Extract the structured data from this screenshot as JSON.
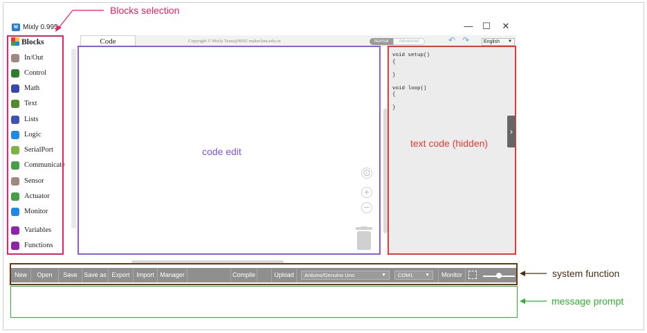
{
  "app": {
    "title": "Mixly 0.995",
    "logo_text": "M"
  },
  "window_controls": {
    "minimize": "—",
    "maximize": "☐",
    "close": "✕"
  },
  "sidebar": {
    "header": "Blocks",
    "items": [
      {
        "label": "In/Out",
        "icon": "inout-icon",
        "color": "#a1887f"
      },
      {
        "label": "Control",
        "icon": "control-icon",
        "color": "#2e7d32"
      },
      {
        "label": "Math",
        "icon": "math-icon",
        "color": "#3949ab"
      },
      {
        "label": "Text",
        "icon": "text-icon",
        "color": "#558b2f"
      },
      {
        "label": "Lists",
        "icon": "lists-icon",
        "color": "#3f51b5"
      },
      {
        "label": "Logic",
        "icon": "logic-icon",
        "color": "#1e88e5"
      },
      {
        "label": "SerialPort",
        "icon": "serialport-icon",
        "color": "#7cb342"
      },
      {
        "label": "Communicate",
        "icon": "communicate-icon",
        "color": "#43a047"
      },
      {
        "label": "Sensor",
        "icon": "sensor-icon",
        "color": "#a1887f"
      },
      {
        "label": "Actuator",
        "icon": "actuator-icon",
        "color": "#43a047"
      },
      {
        "label": "Monitor",
        "icon": "monitor-icon",
        "color": "#1e88e5"
      },
      {
        "label": "Variables",
        "icon": "variables-icon",
        "color": "#8e24aa"
      },
      {
        "label": "Functions",
        "icon": "functions-icon",
        "color": "#8e24aa"
      }
    ]
  },
  "tabs": {
    "code": "Code"
  },
  "copyright": "Copyright © Mixly Team@BNU maker.bnu.edu.cn",
  "mode": {
    "normal": "Normal",
    "advanced": "Advanced"
  },
  "language": {
    "selected": "English"
  },
  "code_text": "void setup()\n{\n\n}\n\nvoid loop()\n{\n\n}",
  "toolbar": {
    "new": "New",
    "open": "Open",
    "save": "Save",
    "save_as": "Save as",
    "export": "Export",
    "import": "Import",
    "manager": "Manager",
    "compile": "Compile",
    "upload": "Upload",
    "board": "Arduino/Genuino Uno",
    "port": "COM1",
    "monitor": "Monitor"
  },
  "annotations": {
    "blocks_selection": "Blocks selection",
    "code_edit": "code edit",
    "text_code": "text code (hidden)",
    "system_function": "system function",
    "message_prompt": "message prompt"
  },
  "colors": {
    "blocks_annotation": "#e91e63",
    "code_edit_annotation": "#7b4fe0",
    "text_code_annotation": "#e53935",
    "system_annotation": "#4a2c10",
    "message_annotation": "#2fb12f",
    "toolbar_bg": "#8f8f8f"
  }
}
